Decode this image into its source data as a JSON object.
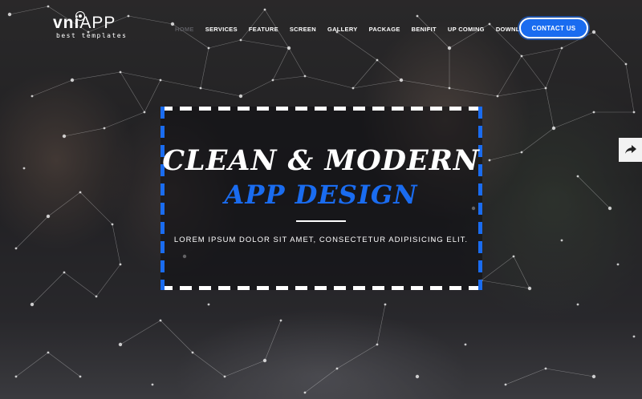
{
  "logo": {
    "brand_bold": "vni",
    "brand_light": "APP",
    "tagline": "best templates"
  },
  "nav": {
    "items": [
      {
        "label": "HOME",
        "active": true
      },
      {
        "label": "SERVICES"
      },
      {
        "label": "FEATURE"
      },
      {
        "label": "SCREEN"
      },
      {
        "label": "GALLERY"
      },
      {
        "label": "PACKAGE"
      },
      {
        "label": "BENIFIT"
      },
      {
        "label": "UP COMING"
      },
      {
        "label": "DOWNLOAD APP"
      }
    ],
    "contact_label": "CONTACT US"
  },
  "hero": {
    "headline": "CLEAN & MODERN",
    "subhead": "APP DESIGN",
    "tagline": "LOREM IPSUM DOLOR SIT AMET, CONSECTETUR ADIPISICING ELIT."
  },
  "share": {
    "icon": "share-arrow-icon"
  },
  "colors": {
    "accent": "#1a6cf0",
    "text": "#ffffff",
    "frame_top": "#ffffff",
    "frame_side": "#1a6cf0"
  }
}
